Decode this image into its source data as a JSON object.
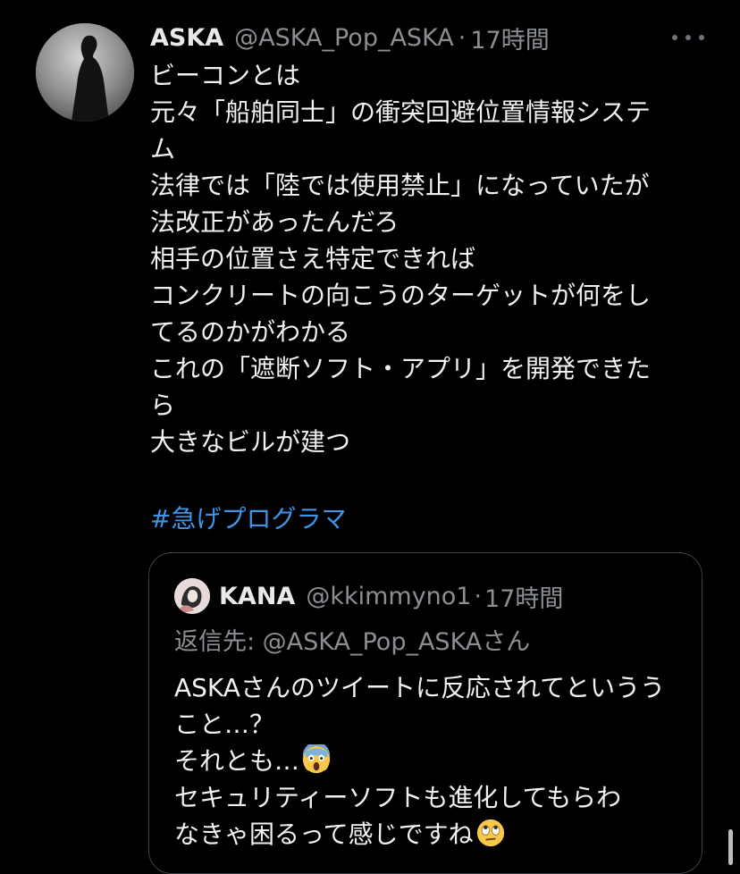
{
  "tweet": {
    "display_name": "ASKA",
    "handle": "@ASKA_Pop_ASKA",
    "separator": "·",
    "time": "17時間",
    "lines": [
      "ビーコンとは",
      "元々「船舶同士」の衝突回避位置情報システ",
      "ム",
      "法律では「陸では使用禁止」になっていたが",
      "法改正があったんだろ",
      "相手の位置さえ特定できれば",
      "コンクリートの向こうのターゲットが何をし",
      "てるのかがわかる",
      "これの「遮断ソフト・アプリ」を開発できた",
      "ら",
      "大きなビルが建つ"
    ],
    "hashtag": "#急げプログラマ",
    "more_icon": "more-horizontal-icon"
  },
  "quote": {
    "display_name": "KANA",
    "handle": "@kkimmyno1",
    "separator": "·",
    "time": "17時間",
    "reply_to": "返信先: @ASKA_Pop_ASKAさん",
    "lines": [
      "ASKAさんのツイートに反応されてというう",
      "こと…？",
      "それとも…",
      "セキュリティーソフトも進化してもらわ",
      "なきゃ困るって感じですね"
    ],
    "emoji_scream": "screaming-face-emoji",
    "emoji_eyeroll": "face-with-rolling-eyes-emoji"
  },
  "colors": {
    "background": "#000000",
    "text": "#f2f2f2",
    "secondary": "#8b8f94",
    "link": "#3e95e8",
    "border": "#3e4144"
  }
}
